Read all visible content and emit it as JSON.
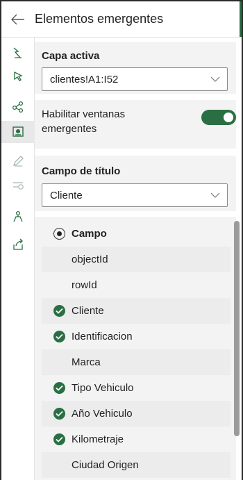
{
  "header": {
    "title": "Elementos emergentes",
    "back_icon": "arrow-left-icon"
  },
  "rail": {
    "items": [
      {
        "name": "style-icon",
        "state": "normal"
      },
      {
        "name": "select-icon",
        "state": "normal"
      },
      {
        "name": "connections-icon",
        "state": "normal"
      },
      {
        "name": "popup-icon",
        "state": "active"
      },
      {
        "name": "edit-icon",
        "state": "disabled"
      },
      {
        "name": "filter-time-icon",
        "state": "disabled"
      },
      {
        "name": "analysis-icon",
        "state": "normal"
      },
      {
        "name": "share-icon",
        "state": "normal"
      }
    ]
  },
  "layer": {
    "label": "Capa activa",
    "value": "clientes!A1:I52"
  },
  "popups": {
    "label": "Habilitar ventanas emergentes",
    "enabled": true
  },
  "title_field": {
    "label": "Campo de título",
    "value": "Cliente"
  },
  "fields": {
    "header": "Campo",
    "items": [
      {
        "label": "objectId",
        "checked": false
      },
      {
        "label": "rowId",
        "checked": false
      },
      {
        "label": "Cliente",
        "checked": true
      },
      {
        "label": "Identificacion",
        "checked": true
      },
      {
        "label": "Marca",
        "checked": false
      },
      {
        "label": "Tipo Vehiculo",
        "checked": true
      },
      {
        "label": "Año Vehiculo",
        "checked": true
      },
      {
        "label": "Kilometraje",
        "checked": true
      },
      {
        "label": "Ciudad Origen",
        "checked": false
      }
    ]
  },
  "colors": {
    "accent": "#2a6f43",
    "panel": "#f3f3f3"
  }
}
